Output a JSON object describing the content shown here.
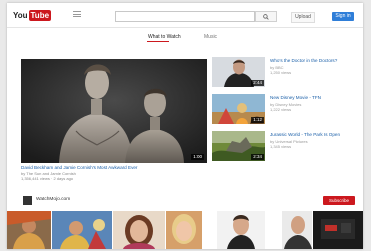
{
  "header": {
    "logo_you": "You",
    "logo_tube": "Tube",
    "search_placeholder": "",
    "upload_label": "Upload",
    "signin_label": "Sign in"
  },
  "tabs": [
    {
      "label": "What to Watch"
    },
    {
      "label": "Music"
    }
  ],
  "featured": {
    "duration": "1:00",
    "title": "David Beckham and Jamie Cornish's Most Awkward Ever",
    "meta1": "by The Sun and Jamie Cornish",
    "meta2": "1,356,441 views · 2 days ago"
  },
  "sidebar": [
    {
      "title": "Who's the Doctor in the Doctors?",
      "meta1": "by BBC",
      "meta2": "1,250 views",
      "duration": "2:44"
    },
    {
      "title": "New Disney Movie - TFN",
      "meta1": "by Disney Movies",
      "meta2": "1,222 views",
      "duration": "1:12"
    },
    {
      "title": "Jurassic World - The Park Is Open",
      "meta1": "by Universal Pictures",
      "meta2": "1,345 views",
      "duration": "2:34"
    }
  ],
  "channel": {
    "name": "WatchMojo.com",
    "sub": "",
    "subscribe_label": "Subscribe"
  },
  "colors": {
    "accent_red": "#cc181e",
    "link_blue": "#1a5fa8",
    "signin_blue": "#2f7ed8"
  },
  "icons": [
    "guide-icon",
    "search-icon"
  ]
}
